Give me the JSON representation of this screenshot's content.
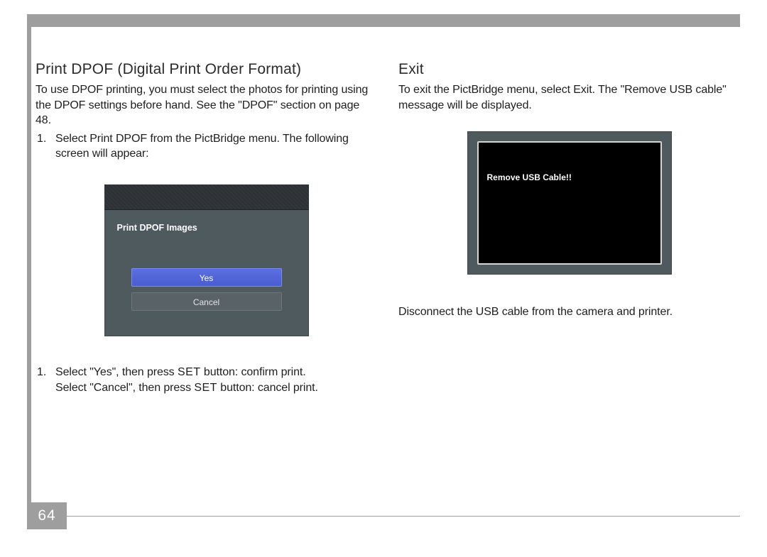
{
  "page_number": "64",
  "left": {
    "heading": "Print DPOF (Digital Print Order Format)",
    "intro": "To use DPOF printing, you must select the photos for printing using the DPOF settings before hand. See the \"DPOF\" section on page 48.",
    "step1": "Select Print DPOF from the PictBridge menu. The following screen will appear:",
    "dialog_title": "Print DPOF Images",
    "dialog_yes": "Yes",
    "dialog_cancel": "Cancel",
    "step2_a": "Select \"Yes\", then press ",
    "step2_set": "SET",
    "step2_b": " button: confirm print.",
    "step2_c": "Select \"Cancel\", then press ",
    "step2_d": " button: cancel print."
  },
  "right": {
    "heading": "Exit",
    "intro": "To exit the PictBridge menu, select Exit. The \"Remove USB cable\" message will be displayed.",
    "message": "Remove USB Cable!!",
    "below": "Disconnect the USB cable from the camera and printer."
  }
}
